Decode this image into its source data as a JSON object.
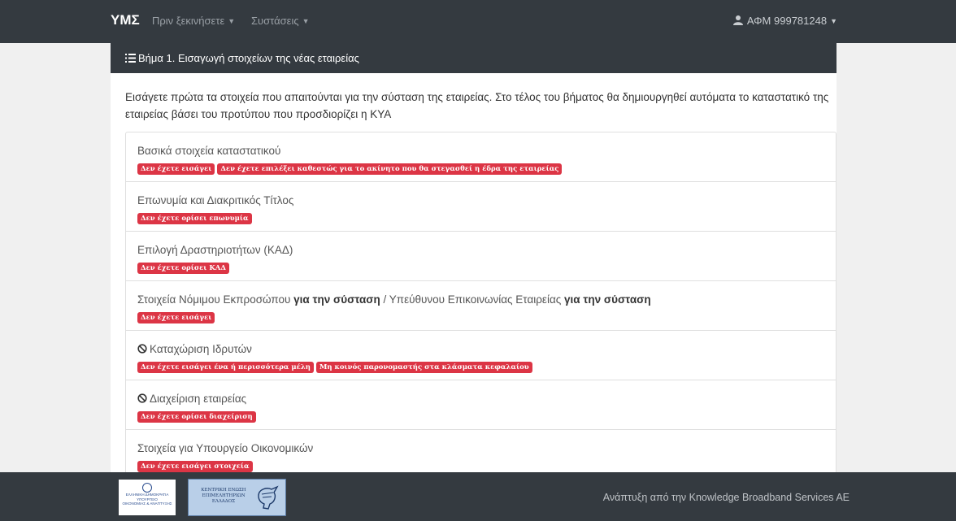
{
  "navbar": {
    "brand": "ΥΜΣ",
    "menu_before": "Πριν ξεκινήσετε",
    "menu_setups": "Συστάσεις",
    "user": "ΑΦΜ 999781248"
  },
  "card": {
    "header": "Βήμα 1. Εισαγωγή στοιχείων της νέας εταιρείας",
    "intro": "Εισάγετε πρώτα τα στοιχεία που απαιτούνται για την σύσταση της εταιρείας. Στο τέλος του βήματος θα δημιουργηθεί αυτόματα το καταστατικό της εταιρείας βάσει του προτύπου που προσδιορίζει η ΚΥΑ",
    "items": [
      {
        "title": "Βασικά στοιχεία καταστατικού",
        "badges": [
          "Δεν έχετε εισάγει",
          "Δεν έχετε επιλέξει καθεστώς για το ακίνητο που θα στεγασθεί η έδρα της εταιρείας"
        ]
      },
      {
        "title": "Επωνυμία και Διακριτικός Τίτλος",
        "badges": [
          "Δεν έχετε ορίσει επωνυμία"
        ]
      },
      {
        "title": "Επιλογή Δραστηριοτήτων (ΚΑΔ)",
        "badges": [
          "Δεν έχετε ορίσει ΚΑΔ"
        ]
      },
      {
        "title_parts": [
          "Στοιχεία Νόμιμου Εκπροσώπου ",
          "για την σύσταση",
          " / Υπεύθυνου Επικοινωνίας Εταιρείας ",
          "για την σύσταση"
        ],
        "badges": [
          "Δεν έχετε εισάγει"
        ]
      },
      {
        "title": "Καταχώριση Ιδρυτών",
        "icon": "ban-icon",
        "badges": [
          "Δεν έχετε εισάγει ένα ή περισσότερα μέλη",
          "Μη κοινός παρονομαστής στα κλάσματα κεφαλαίου"
        ]
      },
      {
        "title": "Διαχείριση εταιρείας",
        "icon": "ban-icon",
        "badges": [
          "Δεν έχετε ορίσει διαχείριση"
        ]
      },
      {
        "title": "Στοιχεία για Υπουργείο Οικονομικών",
        "badges": [
          "Δεν έχετε εισάγει στοιχεία"
        ]
      }
    ]
  },
  "footer": {
    "logo1_lines": [
      "ΕΛΛΗΝΙΚΗ ΔΗΜΟΚΡΑΤΙΑ",
      "ΥΠΟΥΡΓΕΙΟ",
      "ΟΙΚΟΝΟΜΙΑΣ & ΑΝΑΠΤΥΞΗΣ"
    ],
    "logo2_lines": [
      "ΚΕΝΤΡΙΚΗ ΕΝΩΣΗ",
      "ΕΠΙΜΕΛΗΤΗΡΙΩΝ",
      "ΕΛΛΑΔΟΣ"
    ],
    "credit": "Ανάπτυξη από την  Knowledge Broadband Services AE"
  },
  "colors": {
    "navbar": "#343a40",
    "badge": "#dc3545",
    "background": "#f0f0f0"
  }
}
